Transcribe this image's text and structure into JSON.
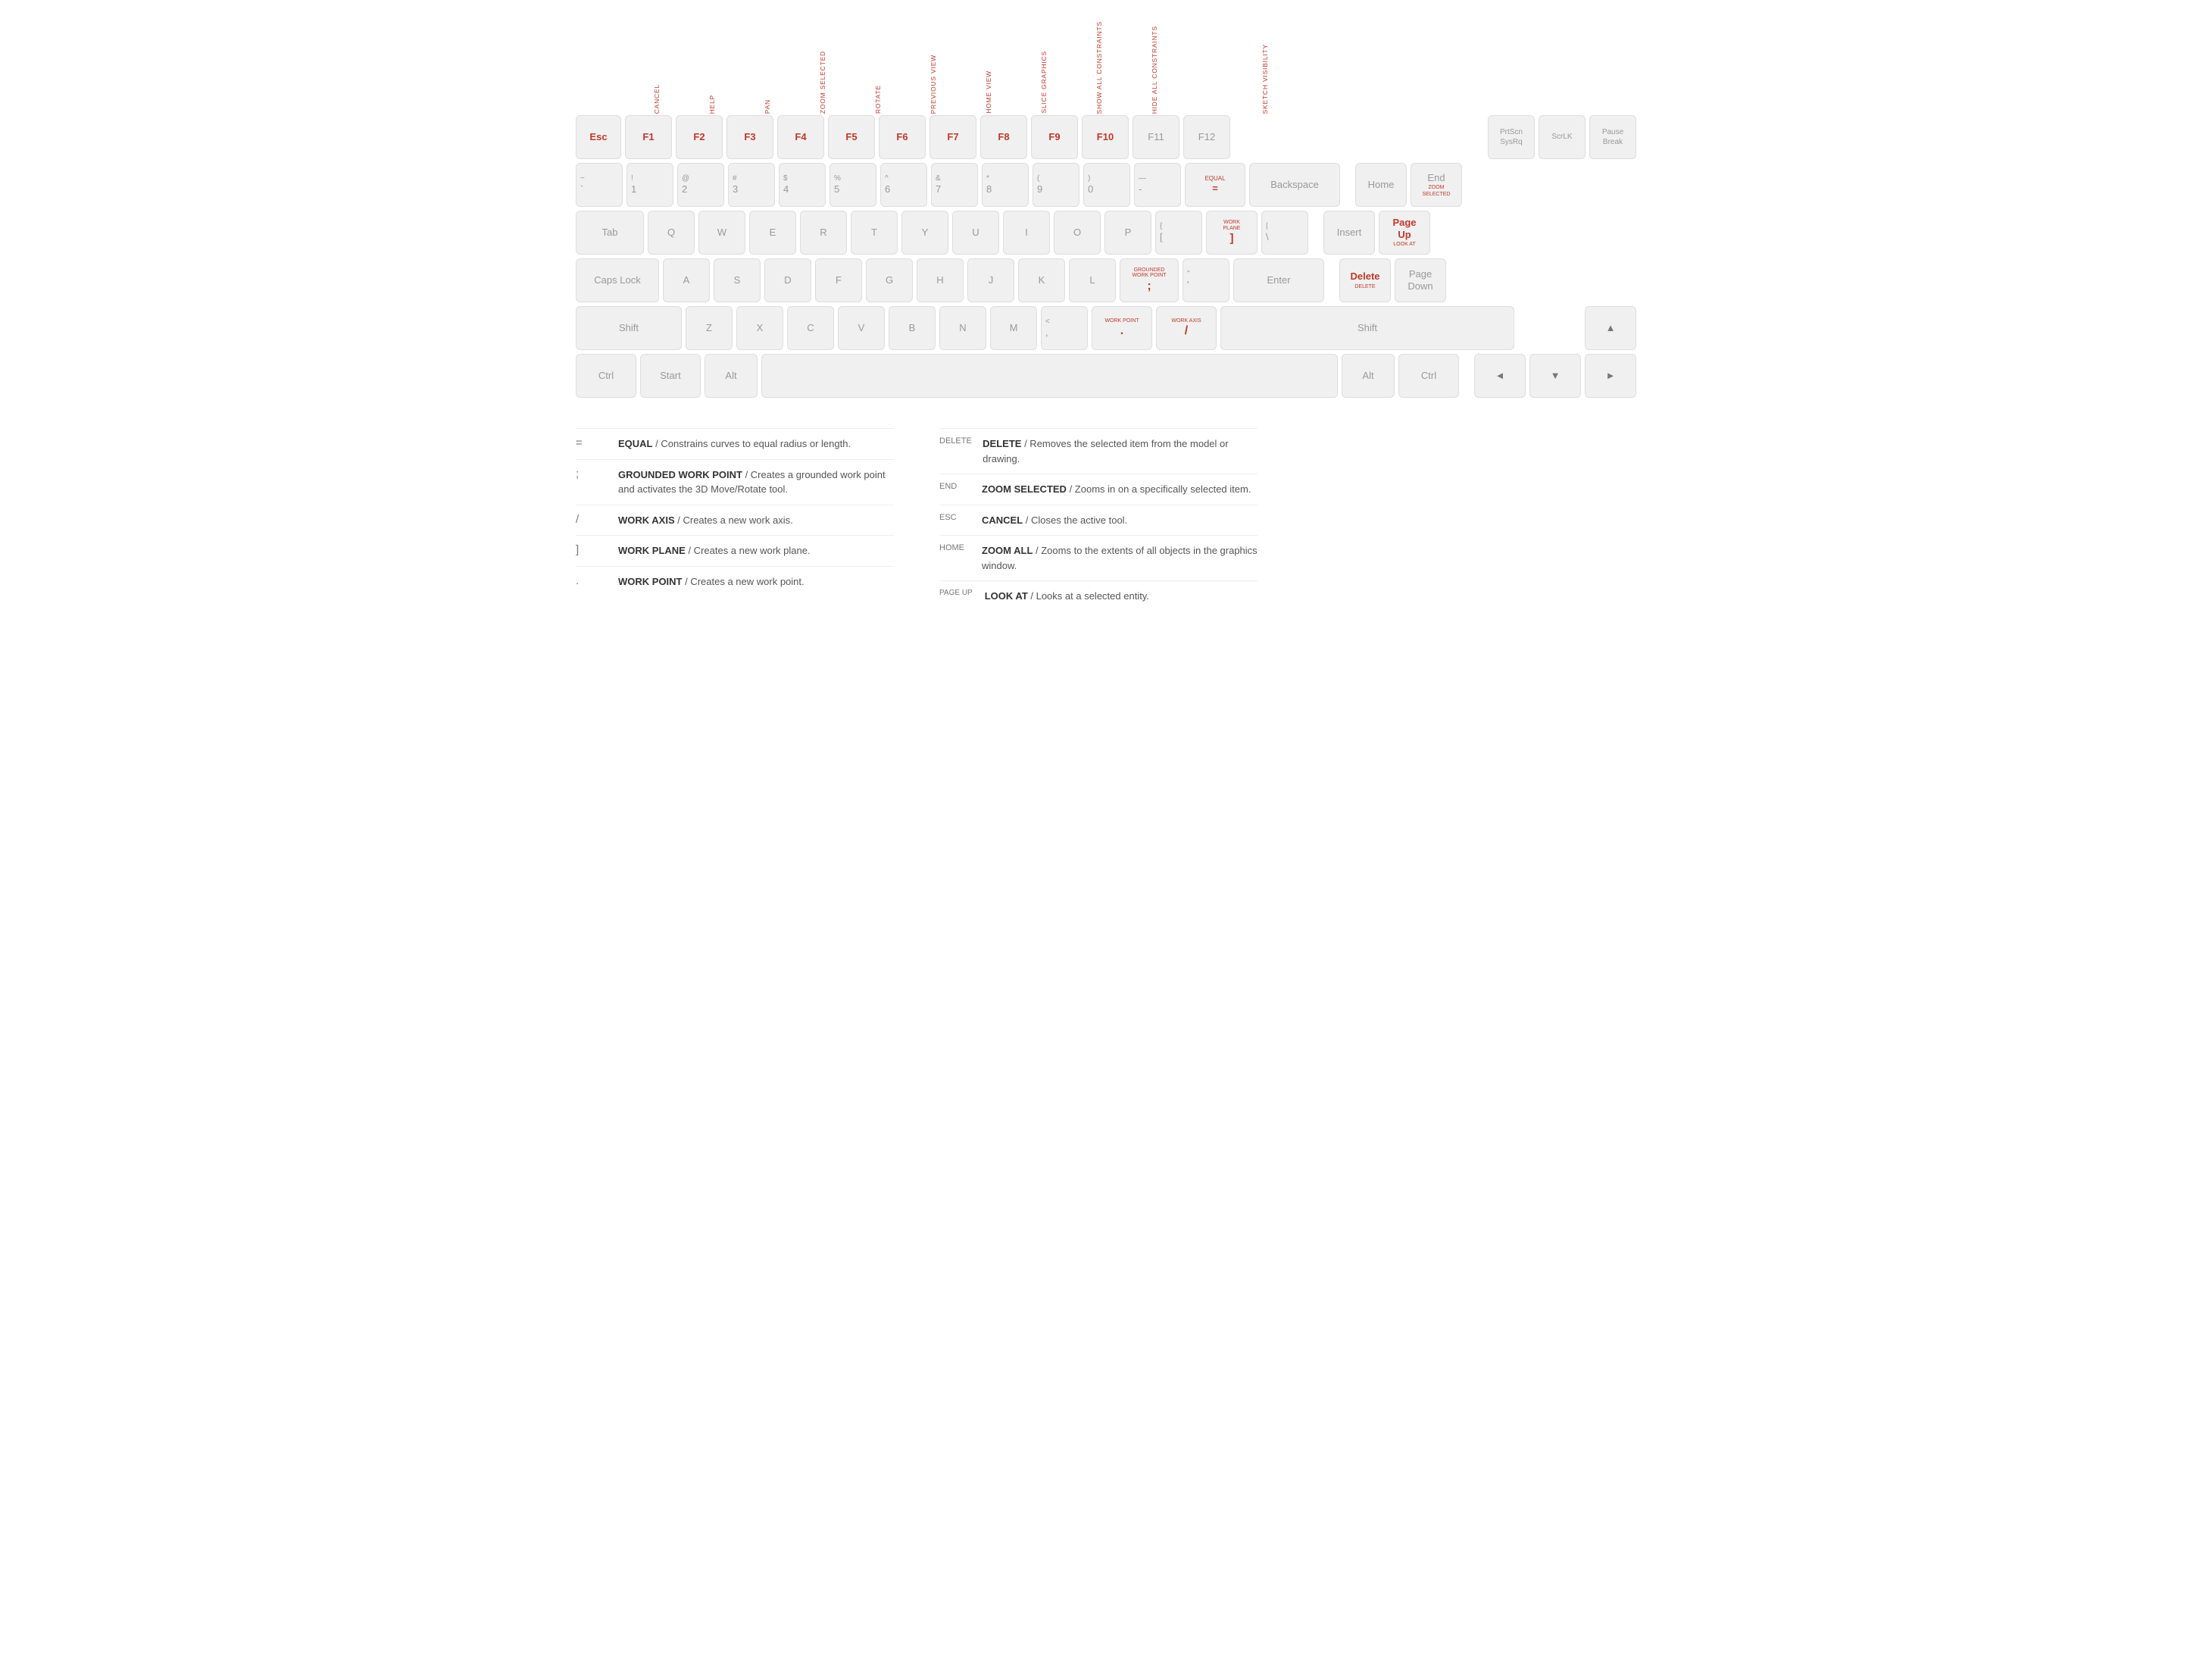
{
  "fn_labels": [
    {
      "key": "F1",
      "label": "CANCEL",
      "offset": 0
    },
    {
      "key": "F2",
      "label": "HELP"
    },
    {
      "key": "F3",
      "label": "PAN"
    },
    {
      "key": "F4",
      "label": "ZOOM SELECTED"
    },
    {
      "key": "F5",
      "label": "ROTATE"
    },
    {
      "key": "F6",
      "label": "PREVIOUS VIEW"
    },
    {
      "key": "F7",
      "label": "HOME VIEW"
    },
    {
      "key": "F8",
      "label": "SLICE GRAPHICS"
    },
    {
      "key": "F9",
      "label": "SHOW ALL CONSTRAINTS"
    },
    {
      "key": "F10",
      "label": "HIDE ALL CONSTRAINTS"
    },
    {
      "key": "F11",
      "label": ""
    },
    {
      "key": "F12",
      "label": "SKETCH VISIBILITY"
    }
  ],
  "rows": {
    "fn_row": {
      "keys": [
        {
          "id": "esc",
          "label": "Esc",
          "active": true
        },
        {
          "id": "f1",
          "label": "F1",
          "active": true
        },
        {
          "id": "f2",
          "label": "F2",
          "active": true
        },
        {
          "id": "f3",
          "label": "F3",
          "active": true
        },
        {
          "id": "f4",
          "label": "F4",
          "active": true
        },
        {
          "id": "f5",
          "label": "F5",
          "active": true
        },
        {
          "id": "f6",
          "label": "F6",
          "active": true
        },
        {
          "id": "f7",
          "label": "F7",
          "active": true
        },
        {
          "id": "f8",
          "label": "F8",
          "active": true
        },
        {
          "id": "f9",
          "label": "F9",
          "active": true
        },
        {
          "id": "f10",
          "label": "F10",
          "active": true
        },
        {
          "id": "f11",
          "label": "F11",
          "active": false
        },
        {
          "id": "f12",
          "label": "F12",
          "active": false
        },
        {
          "id": "prtscn",
          "label": "PrtScn\nSysRq",
          "active": false
        },
        {
          "id": "scrlk",
          "label": "ScrLK",
          "active": false
        },
        {
          "id": "pause",
          "label": "Pause\nBreak",
          "active": false
        }
      ]
    },
    "num_row": {
      "keys": [
        {
          "id": "tilde",
          "top": "~",
          "bot": "`"
        },
        {
          "id": "1",
          "top": "!",
          "bot": "1"
        },
        {
          "id": "2",
          "top": "@",
          "bot": "2"
        },
        {
          "id": "3",
          "top": "#",
          "bot": "3"
        },
        {
          "id": "4",
          "top": "$",
          "bot": "4"
        },
        {
          "id": "5",
          "top": "%",
          "bot": "5"
        },
        {
          "id": "6",
          "top": "^",
          "bot": "6"
        },
        {
          "id": "7",
          "top": "&",
          "bot": "7"
        },
        {
          "id": "8",
          "top": "*",
          "bot": "8"
        },
        {
          "id": "9",
          "top": "(",
          "bot": "9"
        },
        {
          "id": "0",
          "top": ")",
          "bot": "0"
        },
        {
          "id": "minus",
          "top": "—",
          "bot": "-"
        },
        {
          "id": "equal",
          "top": "EQUAL",
          "bot": "=",
          "active": true
        },
        {
          "id": "backspace",
          "label": "Backspace"
        }
      ]
    },
    "tab_row": {
      "keys": [
        {
          "id": "tab",
          "label": "Tab"
        },
        {
          "id": "q",
          "label": "Q"
        },
        {
          "id": "w",
          "label": "W"
        },
        {
          "id": "e",
          "label": "E"
        },
        {
          "id": "r",
          "label": "R"
        },
        {
          "id": "t",
          "label": "T"
        },
        {
          "id": "y",
          "label": "Y"
        },
        {
          "id": "u",
          "label": "U"
        },
        {
          "id": "i",
          "label": "I"
        },
        {
          "id": "o",
          "label": "O"
        },
        {
          "id": "p",
          "label": "P"
        },
        {
          "id": "bracket_open",
          "top": "{",
          "bot": "["
        },
        {
          "id": "bracket_close",
          "top": "WORK PLANE",
          "bot": "]",
          "active": true
        },
        {
          "id": "backslash",
          "top": "|",
          "bot": "\\"
        }
      ]
    },
    "caps_row": {
      "keys": [
        {
          "id": "caps",
          "label": "Caps Lock"
        },
        {
          "id": "a",
          "label": "A"
        },
        {
          "id": "s",
          "label": "S"
        },
        {
          "id": "d",
          "label": "D"
        },
        {
          "id": "f",
          "label": "F"
        },
        {
          "id": "g",
          "label": "G"
        },
        {
          "id": "h",
          "label": "H"
        },
        {
          "id": "j",
          "label": "J"
        },
        {
          "id": "k",
          "label": "K"
        },
        {
          "id": "l",
          "label": "L"
        },
        {
          "id": "semicolon",
          "top": "GROUNDED WORK POINT",
          "bot": ";",
          "active": true
        },
        {
          "id": "quote",
          "top": "\"",
          "bot": "'"
        },
        {
          "id": "enter",
          "label": "Enter"
        }
      ]
    },
    "shift_row": {
      "keys": [
        {
          "id": "shift_l",
          "label": "Shift"
        },
        {
          "id": "z",
          "label": "Z"
        },
        {
          "id": "x",
          "label": "X"
        },
        {
          "id": "c",
          "label": "C"
        },
        {
          "id": "v",
          "label": "V"
        },
        {
          "id": "b",
          "label": "B"
        },
        {
          "id": "n",
          "label": "N"
        },
        {
          "id": "m",
          "label": "M"
        },
        {
          "id": "comma",
          "top": "<",
          "bot": ","
        },
        {
          "id": "period",
          "top": "WORK POINT",
          "bot": ".",
          "active": true
        },
        {
          "id": "slash",
          "top": "WORK AXIS",
          "bot": "/",
          "active": true
        },
        {
          "id": "shift_r",
          "label": "Shift"
        }
      ]
    },
    "ctrl_row": {
      "keys": [
        {
          "id": "ctrl_l",
          "label": "Ctrl"
        },
        {
          "id": "start",
          "label": "Start"
        },
        {
          "id": "alt_l",
          "label": "Alt"
        },
        {
          "id": "space",
          "label": ""
        },
        {
          "id": "alt_r",
          "label": "Alt"
        },
        {
          "id": "ctrl_r",
          "label": "Ctrl"
        }
      ]
    }
  },
  "nav_cluster": {
    "top_row": [
      {
        "id": "home",
        "label": "Home",
        "active": false
      },
      {
        "id": "end",
        "label": "End",
        "sub": "ZOOM\nSELECTED",
        "active": true
      }
    ],
    "mid_rows": [
      {
        "left": {
          "id": "insert",
          "label": "Insert"
        },
        "right": {
          "id": "pageup",
          "label": "Page\nUp",
          "sub": "LOOK AT",
          "active": true
        }
      },
      {
        "left": {
          "id": "delete",
          "label": "Delete",
          "sub": "DELETE",
          "active": true
        },
        "right": {
          "id": "pagedown",
          "label": "Page\nDown",
          "active": false
        }
      }
    ],
    "arrow_rows": [
      {
        "id": "up",
        "label": "▲"
      },
      {
        "id": "left",
        "label": "◄"
      },
      {
        "id": "down",
        "label": "▼"
      },
      {
        "id": "right",
        "label": "►"
      }
    ]
  },
  "legend": {
    "left": [
      {
        "key": "=",
        "title": "EQUAL",
        "desc": "Constrains curves to equal radius or length."
      },
      {
        "key": ";",
        "title": "GROUNDED WORK POINT",
        "desc": "Creates a grounded work point and activates the 3D Move/Rotate tool."
      },
      {
        "key": "/",
        "title": "WORK AXIS",
        "desc": "Creates a new work axis."
      },
      {
        "key": "]",
        "title": "WORK PLANE",
        "desc": "Creates a new work plane."
      },
      {
        "key": ".",
        "title": "WORK POINT",
        "desc": "Creates a new work point."
      }
    ],
    "right": [
      {
        "key": "DELETE",
        "title": "DELETE",
        "desc": "Removes the selected item from the model or drawing."
      },
      {
        "key": "END",
        "title": "ZOOM SELECTED",
        "desc": "Zooms in on a specifically selected item."
      },
      {
        "key": "ESC",
        "title": "CANCEL",
        "desc": "Closes the active tool."
      },
      {
        "key": "HOME",
        "title": "ZOOM ALL",
        "desc": "Zooms to the extents of all objects in the graphics window."
      },
      {
        "key": "PAGE UP",
        "title": "LOOK AT",
        "desc": "Looks at a selected entity."
      }
    ]
  }
}
